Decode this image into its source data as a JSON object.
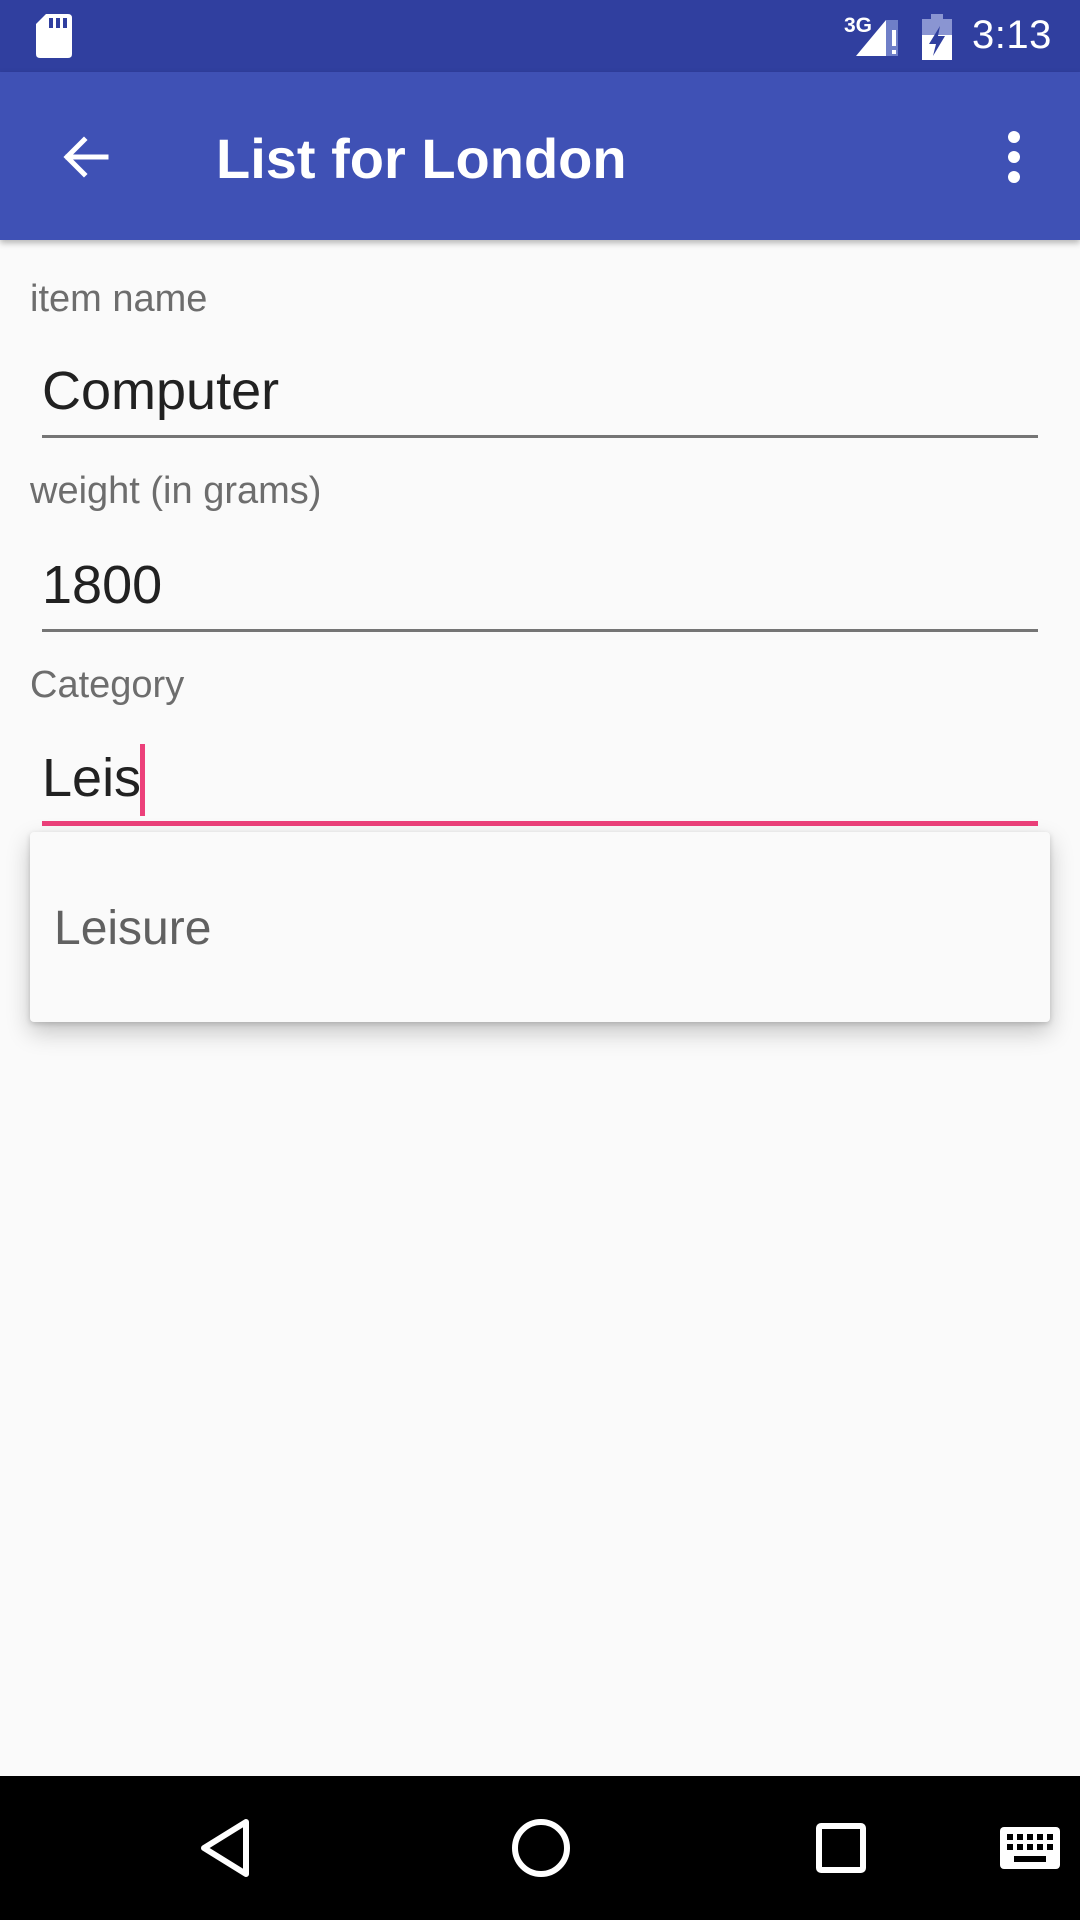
{
  "status_bar": {
    "network": "3G",
    "time": "3:13"
  },
  "app_bar": {
    "title": "List for London",
    "back_icon": "arrow-back-icon",
    "overflow_icon": "more-vert-icon"
  },
  "form": {
    "item_name": {
      "label": "item name",
      "value": "Computer"
    },
    "weight": {
      "label": "weight (in grams)",
      "value": "1800"
    },
    "category": {
      "label": "Category",
      "value": "Leis"
    }
  },
  "autocomplete": {
    "suggestions": [
      "Leisure"
    ]
  },
  "colors": {
    "status_bar": "#303f9f",
    "app_bar": "#3f51b5",
    "accent": "#ec407a"
  }
}
